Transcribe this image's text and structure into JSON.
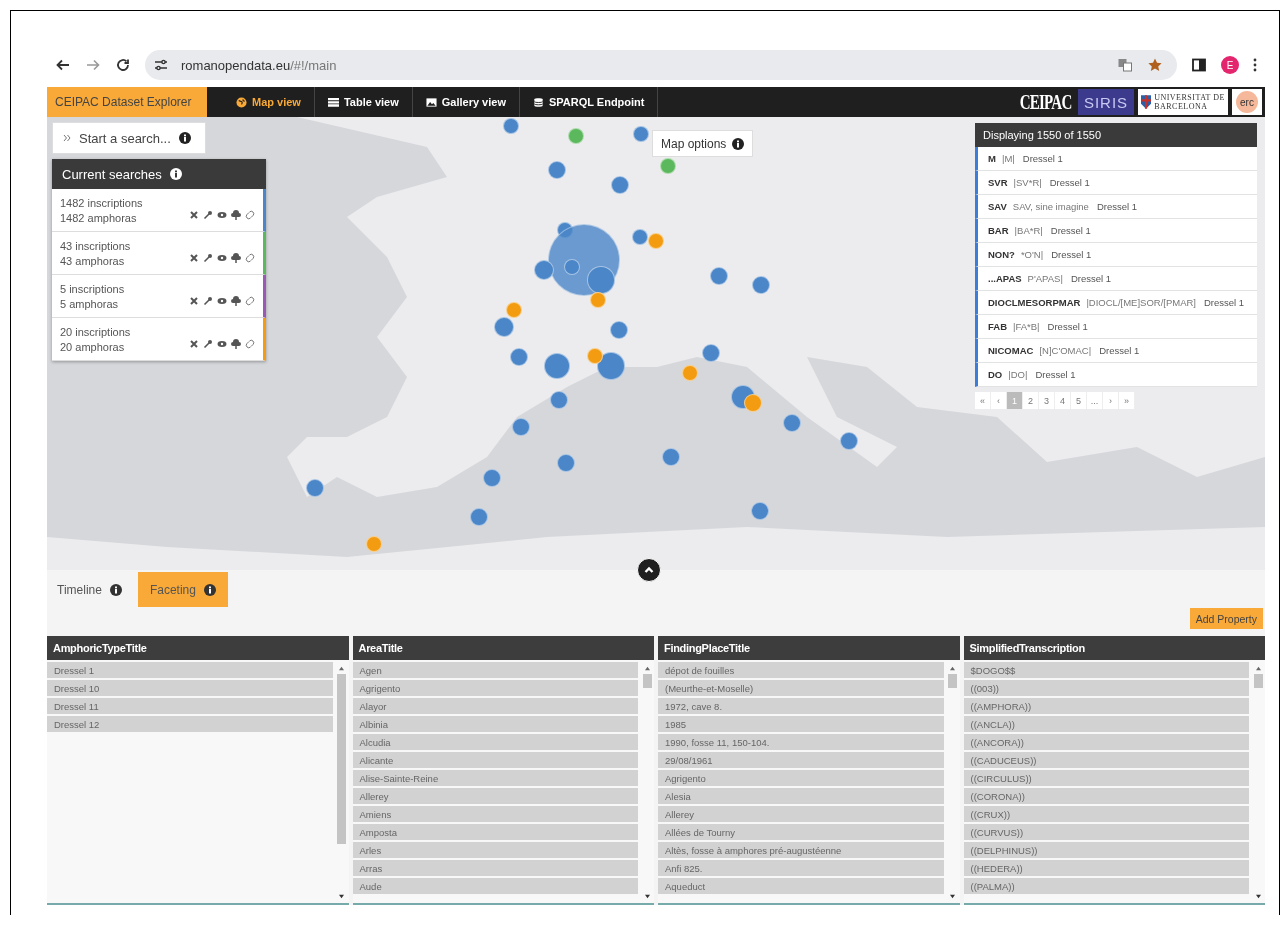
{
  "browser": {
    "url_host": "romanopendata.eu",
    "url_path": "/#!/main",
    "avatar": "E"
  },
  "app_title": "CEIPAC Dataset Explorer",
  "nav": [
    {
      "label": "Map view",
      "kind": "globe",
      "selected": true
    },
    {
      "label": "Table view",
      "kind": "table",
      "selected": false
    },
    {
      "label": "Gallery view",
      "kind": "image",
      "selected": false
    },
    {
      "label": "SPARQL Endpoint",
      "kind": "database",
      "selected": false
    }
  ],
  "logos": [
    {
      "kind": "ceipac",
      "text": "CEIPAC"
    },
    {
      "kind": "siris",
      "text": "SIRIS"
    },
    {
      "kind": "ub",
      "line1": "UNIVERSITAT DE",
      "line2": "BARCELONA"
    },
    {
      "kind": "erc",
      "text": "erc"
    }
  ],
  "search_button": "Start a search...",
  "current_searches": {
    "title": "Current searches",
    "items": [
      {
        "inscriptions": "1482 inscriptions",
        "amphoras": "1482 amphoras",
        "color": "#4a86c8"
      },
      {
        "inscriptions": "43 inscriptions",
        "amphoras": "43 amphoras",
        "color": "#5cb85c"
      },
      {
        "inscriptions": "5 inscriptions",
        "amphoras": "5 amphoras",
        "color": "#9b59b6"
      },
      {
        "inscriptions": "20 inscriptions",
        "amphoras": "20 amphoras",
        "color": "#f39c12"
      }
    ]
  },
  "map_options": "Map options",
  "results": {
    "title": "Displaying 1550 of 1550",
    "rows": [
      {
        "code": "M",
        "transcription": "|M|",
        "type": "Dressel 1"
      },
      {
        "code": "SVR",
        "transcription": "|SV*R|",
        "type": "Dressel 1"
      },
      {
        "code": "SAV",
        "transcription": "SAV, sine imagine",
        "type": "Dressel 1"
      },
      {
        "code": "BAR",
        "transcription": "|BA*R|",
        "type": "Dressel 1"
      },
      {
        "code": "NON?",
        "transcription": "*O'N|",
        "type": "Dressel 1"
      },
      {
        "code": "...APAS",
        "transcription": "P'APAS|",
        "type": "Dressel 1"
      },
      {
        "code": "DIOCLMESORPMAR",
        "transcription": "|DIOCL/[ME]SOR/[PMAR]",
        "type": "Dressel 1"
      },
      {
        "code": "FAB",
        "transcription": "|FA*B|",
        "type": "Dressel 1"
      },
      {
        "code": "NICOMAC",
        "transcription": "[N]C'OMAC|",
        "type": "Dressel 1"
      },
      {
        "code": "DO",
        "transcription": "|DO|",
        "type": "Dressel 1"
      }
    ],
    "pages": [
      {
        "label": "«",
        "selected": false
      },
      {
        "label": "‹",
        "selected": false
      },
      {
        "label": "1",
        "selected": true
      },
      {
        "label": "2",
        "selected": false
      },
      {
        "label": "3",
        "selected": false
      },
      {
        "label": "4",
        "selected": false
      },
      {
        "label": "5",
        "selected": false
      },
      {
        "label": "...",
        "selected": false
      },
      {
        "label": "›",
        "selected": false
      },
      {
        "label": "»",
        "selected": false
      }
    ]
  },
  "bottom_tabs": [
    {
      "label": "Timeline",
      "selected": false
    },
    {
      "label": "Faceting",
      "selected": true
    }
  ],
  "add_property": "Add Property",
  "facets": [
    {
      "title": "AmphoricTypeTitle",
      "items": [
        "Dressel 1",
        "Dressel 10",
        "Dressel 11",
        "Dressel 12"
      ]
    },
    {
      "title": "AreaTitle",
      "items": [
        "Agen",
        "Agrigento",
        "Alayor",
        "Albinia",
        "Alcudia",
        "Alicante",
        "Alise-Sainte-Reine",
        "Allerey",
        "Amiens",
        "Amposta",
        "Arles",
        "Arras",
        "Aude"
      ]
    },
    {
      "title": "FindingPlaceTitle",
      "items": [
        "dépot de fouilles",
        "(Meurthe-et-Moselle)",
        "1972, cave 8.",
        "1985",
        "1990, fosse 11, 150-104.",
        "29/08/1961",
        "Agrigento",
        "Alesia",
        "Allerey",
        "Allées de Tourny",
        "Altès, fosse à amphores pré-augustéenne",
        "Anfi 825.",
        "Aqueduct"
      ]
    },
    {
      "title": "SimplifiedTranscription",
      "items": [
        "$DOGO$$",
        "((003))",
        "((AMPHORA))",
        "((ANCLA))",
        "((ANCORA))",
        "((CADUCEUS))",
        "((CIRCULUS))",
        "((CORONA))",
        "((CRUX))",
        "((CURVUS))",
        "((DELPHINUS))",
        "((HEDERA))",
        "((PALMA))"
      ]
    }
  ]
}
